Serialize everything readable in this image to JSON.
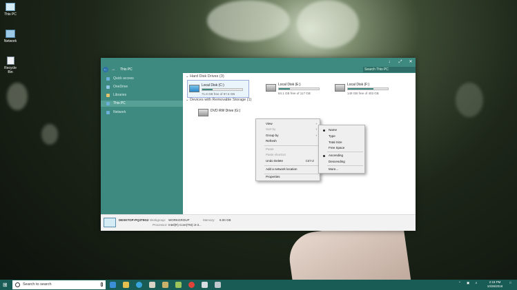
{
  "desktop": {
    "icons": [
      {
        "label": "This PC",
        "icon": "this-pc-icon"
      },
      {
        "label": "Network",
        "icon": "network-icon"
      },
      {
        "label": "Recycle Bin",
        "icon": "recycle-bin-icon"
      }
    ]
  },
  "window": {
    "controls": {
      "minimize": "↓",
      "maximize": "⤢",
      "close": "✕"
    },
    "address": "This PC",
    "search_placeholder": "Search This PC",
    "nav": {
      "back": "←",
      "forward": "→"
    },
    "sidebar": [
      {
        "label": "Quick access",
        "color": "#6ab0d8"
      },
      {
        "label": "OneDrive",
        "color": "#8fc6e6"
      },
      {
        "label": "Libraries",
        "color": "#e2c36b"
      },
      {
        "label": "This PC",
        "color": "#6ab0d8"
      },
      {
        "label": "Network",
        "color": "#6ab0d8"
      }
    ],
    "groups": {
      "hard_drives": "Hard Disk Drives (3)",
      "removable": "Devices with Removable Storage (1)"
    },
    "drives": [
      {
        "name": "Local Disk (C:)",
        "free": "71.8 GB free of 97.6 GB",
        "used_fraction": 0.26
      },
      {
        "name": "Local Disk (E:)",
        "free": "84.1 GB free of 117 GB",
        "used_fraction": 0.28
      },
      {
        "name": "Local Disk (F:)",
        "free": "149 GB free of 403 GB",
        "used_fraction": 0.63
      }
    ],
    "dvd": {
      "name": "DVD RW Drive (G:)"
    },
    "details": {
      "computer_name": "DESKTOP-PQ3T9G2",
      "workgroup_label": "Workgroup:",
      "workgroup": "WORKGROUP",
      "memory_label": "Memory:",
      "memory": "8.00 GB",
      "processor_label": "Processor:",
      "processor": "Intel(R) Core(TM) i3-3..."
    }
  },
  "context_menu": {
    "items": [
      {
        "label": "View",
        "submenu": true,
        "disabled": false
      },
      {
        "label": "Sort by",
        "submenu": true,
        "disabled": true
      },
      {
        "label": "Group by",
        "submenu": true,
        "disabled": false
      },
      {
        "label": "Refresh",
        "submenu": false,
        "disabled": false
      },
      {
        "label": "Paste",
        "submenu": false,
        "disabled": true
      },
      {
        "label": "Paste shortcut",
        "submenu": false,
        "disabled": true
      },
      {
        "label": "Undo Delete",
        "shortcut": "Ctrl+Z",
        "submenu": false,
        "disabled": false
      },
      {
        "label": "Add a network location",
        "submenu": false,
        "disabled": false
      },
      {
        "label": "Properties",
        "submenu": false,
        "disabled": false
      }
    ]
  },
  "group_submenu": {
    "items": [
      {
        "label": "Name",
        "selected": true
      },
      {
        "label": "Type",
        "selected": false
      },
      {
        "label": "Total Size",
        "selected": false
      },
      {
        "label": "Free Space",
        "selected": false
      },
      {
        "label": "Ascending",
        "selected": true
      },
      {
        "label": "Descending",
        "selected": false
      },
      {
        "label": "More...",
        "selected": false
      }
    ]
  },
  "taskbar": {
    "search_placeholder": "Search to search",
    "time": "2:18 PM",
    "date": "10/26/2018",
    "accent": "#195c55"
  }
}
